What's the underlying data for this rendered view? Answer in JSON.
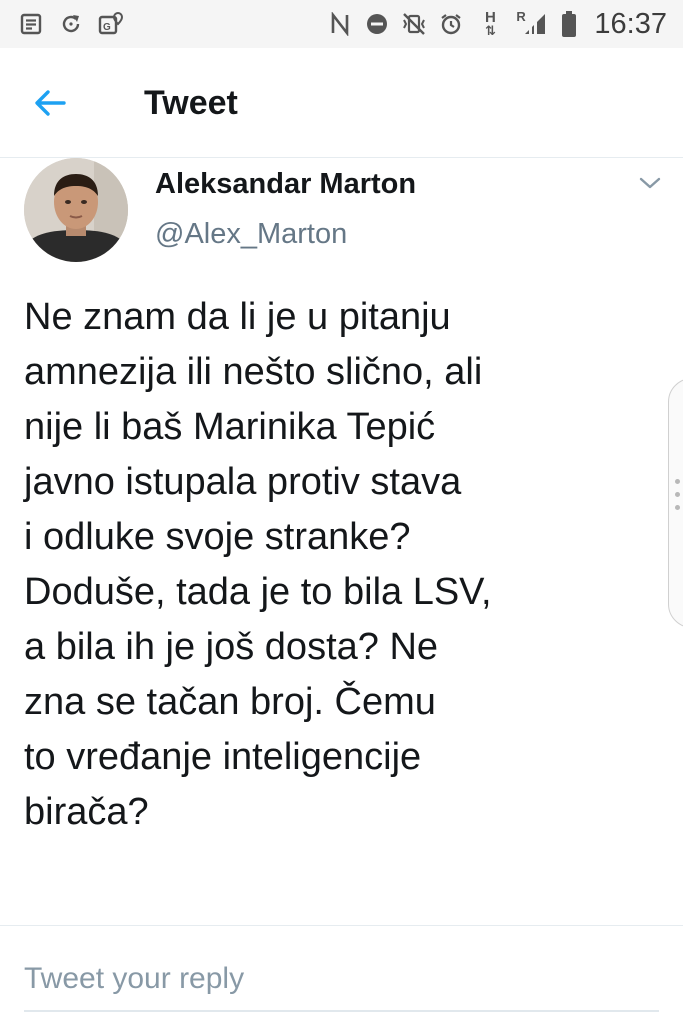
{
  "status_bar": {
    "time": "16:37",
    "network_label_h": "H",
    "network_label_r": "R",
    "left_icons": [
      "notes-icon",
      "sync-icon",
      "gallery-location-icon"
    ],
    "right_icons": [
      "nfc-icon",
      "do-not-disturb-icon",
      "vibrate-off-icon",
      "alarm-icon",
      "data-arrows-icon",
      "signal-icon",
      "battery-icon"
    ]
  },
  "header": {
    "title": "Tweet",
    "back_icon": "arrow-left-icon",
    "accent_color": "#1da1f2"
  },
  "author": {
    "name": "Aleksandar Marton",
    "handle": "@Alex_Marton",
    "menu_icon": "chevron-down-icon"
  },
  "tweet": {
    "text": "Ne znam da li je u pitanju\namnezija ili nešto slično, ali\nnije li baš Marinika Tepić\njavno istupala protiv stava\ni odluke svoje stranke?\nDoduše, tada je to bila LSV,\na bila ih je još dosta? Ne\nzna se tačan broj. Čemu\nto vređanje inteligencije\nbirača?"
  },
  "reply": {
    "placeholder": "Tweet your reply"
  }
}
